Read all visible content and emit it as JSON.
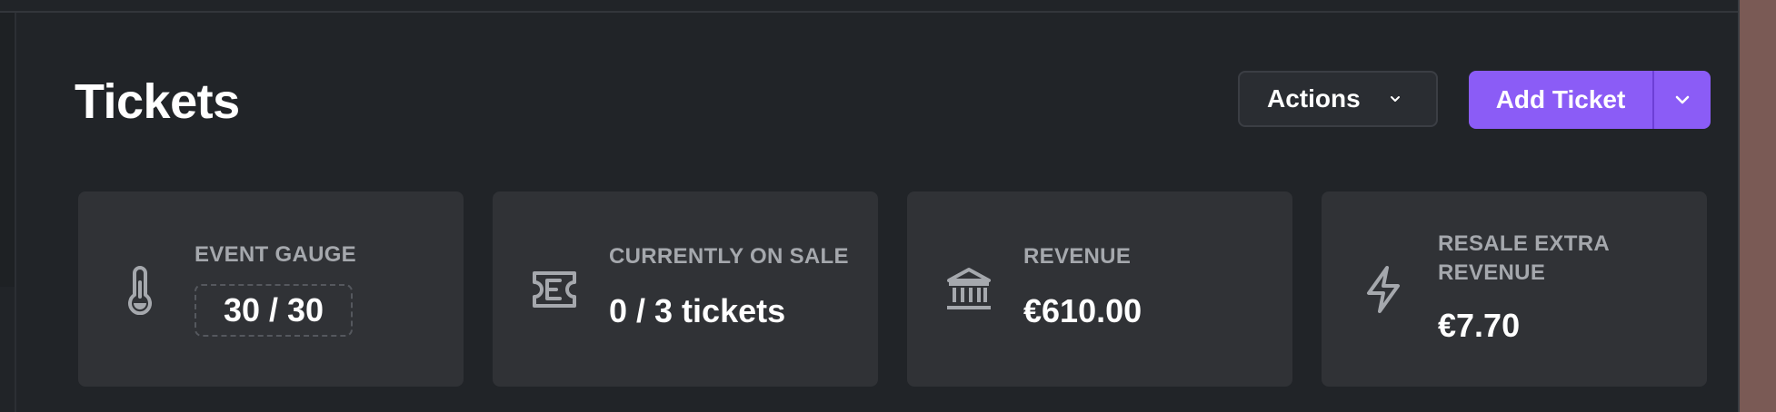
{
  "page": {
    "title": "Tickets"
  },
  "header": {
    "actions_label": "Actions",
    "add_ticket_label": "Add Ticket"
  },
  "stats": [
    {
      "label": "EVENT GAUGE",
      "value": "30 / 30",
      "icon": "thermometer-icon"
    },
    {
      "label": "CURRENTLY ON SALE",
      "value": "0 / 3 tickets",
      "icon": "ticket-icon"
    },
    {
      "label": "REVENUE",
      "value": "€610.00",
      "icon": "bank-icon"
    },
    {
      "label": "RESALE EXTRA REVENUE",
      "value": "€7.70",
      "icon": "lightning-icon"
    }
  ],
  "colors": {
    "background": "#212428",
    "card": "#303236",
    "accent": "#8b5cf6",
    "muted_text": "#a5a8ad"
  }
}
